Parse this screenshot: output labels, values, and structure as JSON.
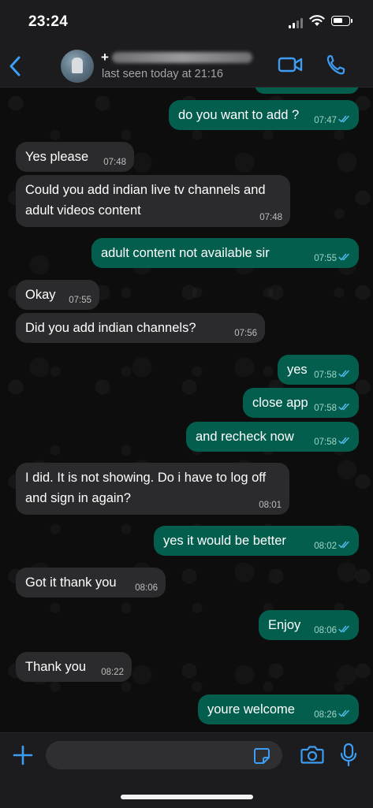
{
  "status_bar": {
    "time": "23:24"
  },
  "header": {
    "contact_name_visible": "+",
    "presence": "last seen today at 21:16",
    "icons": {
      "back": "chevron-left-icon",
      "video": "video-camera-icon",
      "call": "phone-icon"
    },
    "accent_color": "#3d9df3"
  },
  "messages": [
    {
      "dir": "out",
      "text": "do you want to add ?",
      "time": "07:47",
      "read": true
    },
    {
      "dir": "in",
      "text": "Yes please",
      "time": "07:48"
    },
    {
      "dir": "in",
      "text": "Could you add indian live tv channels and adult videos content",
      "time": "07:48"
    },
    {
      "dir": "out",
      "text": "adult content not available sir",
      "time": "07:55",
      "read": true
    },
    {
      "dir": "in",
      "text": "Okay",
      "time": "07:55"
    },
    {
      "dir": "in",
      "text": "Did you add indian channels?",
      "time": "07:56"
    },
    {
      "dir": "out",
      "text": "yes",
      "time": "07:58",
      "read": true
    },
    {
      "dir": "out",
      "text": "close app",
      "time": "07:58",
      "read": true
    },
    {
      "dir": "out",
      "text": "and recheck now",
      "time": "07:58",
      "read": true
    },
    {
      "dir": "in",
      "text": "I did. It is not showing. Do i have to log off and sign in again?",
      "time": "08:01"
    },
    {
      "dir": "out",
      "text": "yes it would be better",
      "time": "08:02",
      "read": true
    },
    {
      "dir": "in",
      "text": "Got it thank you",
      "time": "08:06"
    },
    {
      "dir": "out",
      "text": "Enjoy",
      "time": "08:06",
      "read": true
    },
    {
      "dir": "in",
      "text": "Thank you",
      "time": "08:22"
    },
    {
      "dir": "out",
      "text": "youre welcome",
      "time": "08:26",
      "read": true
    }
  ],
  "composer": {
    "input_value": "",
    "icons": {
      "attach": "plus-icon",
      "sticker": "sticker-icon",
      "camera": "camera-icon",
      "mic": "microphone-icon"
    }
  },
  "colors": {
    "incoming_bubble": "#2b2b2d",
    "outgoing_bubble": "#045e4e",
    "read_tick": "#53bdeb"
  }
}
